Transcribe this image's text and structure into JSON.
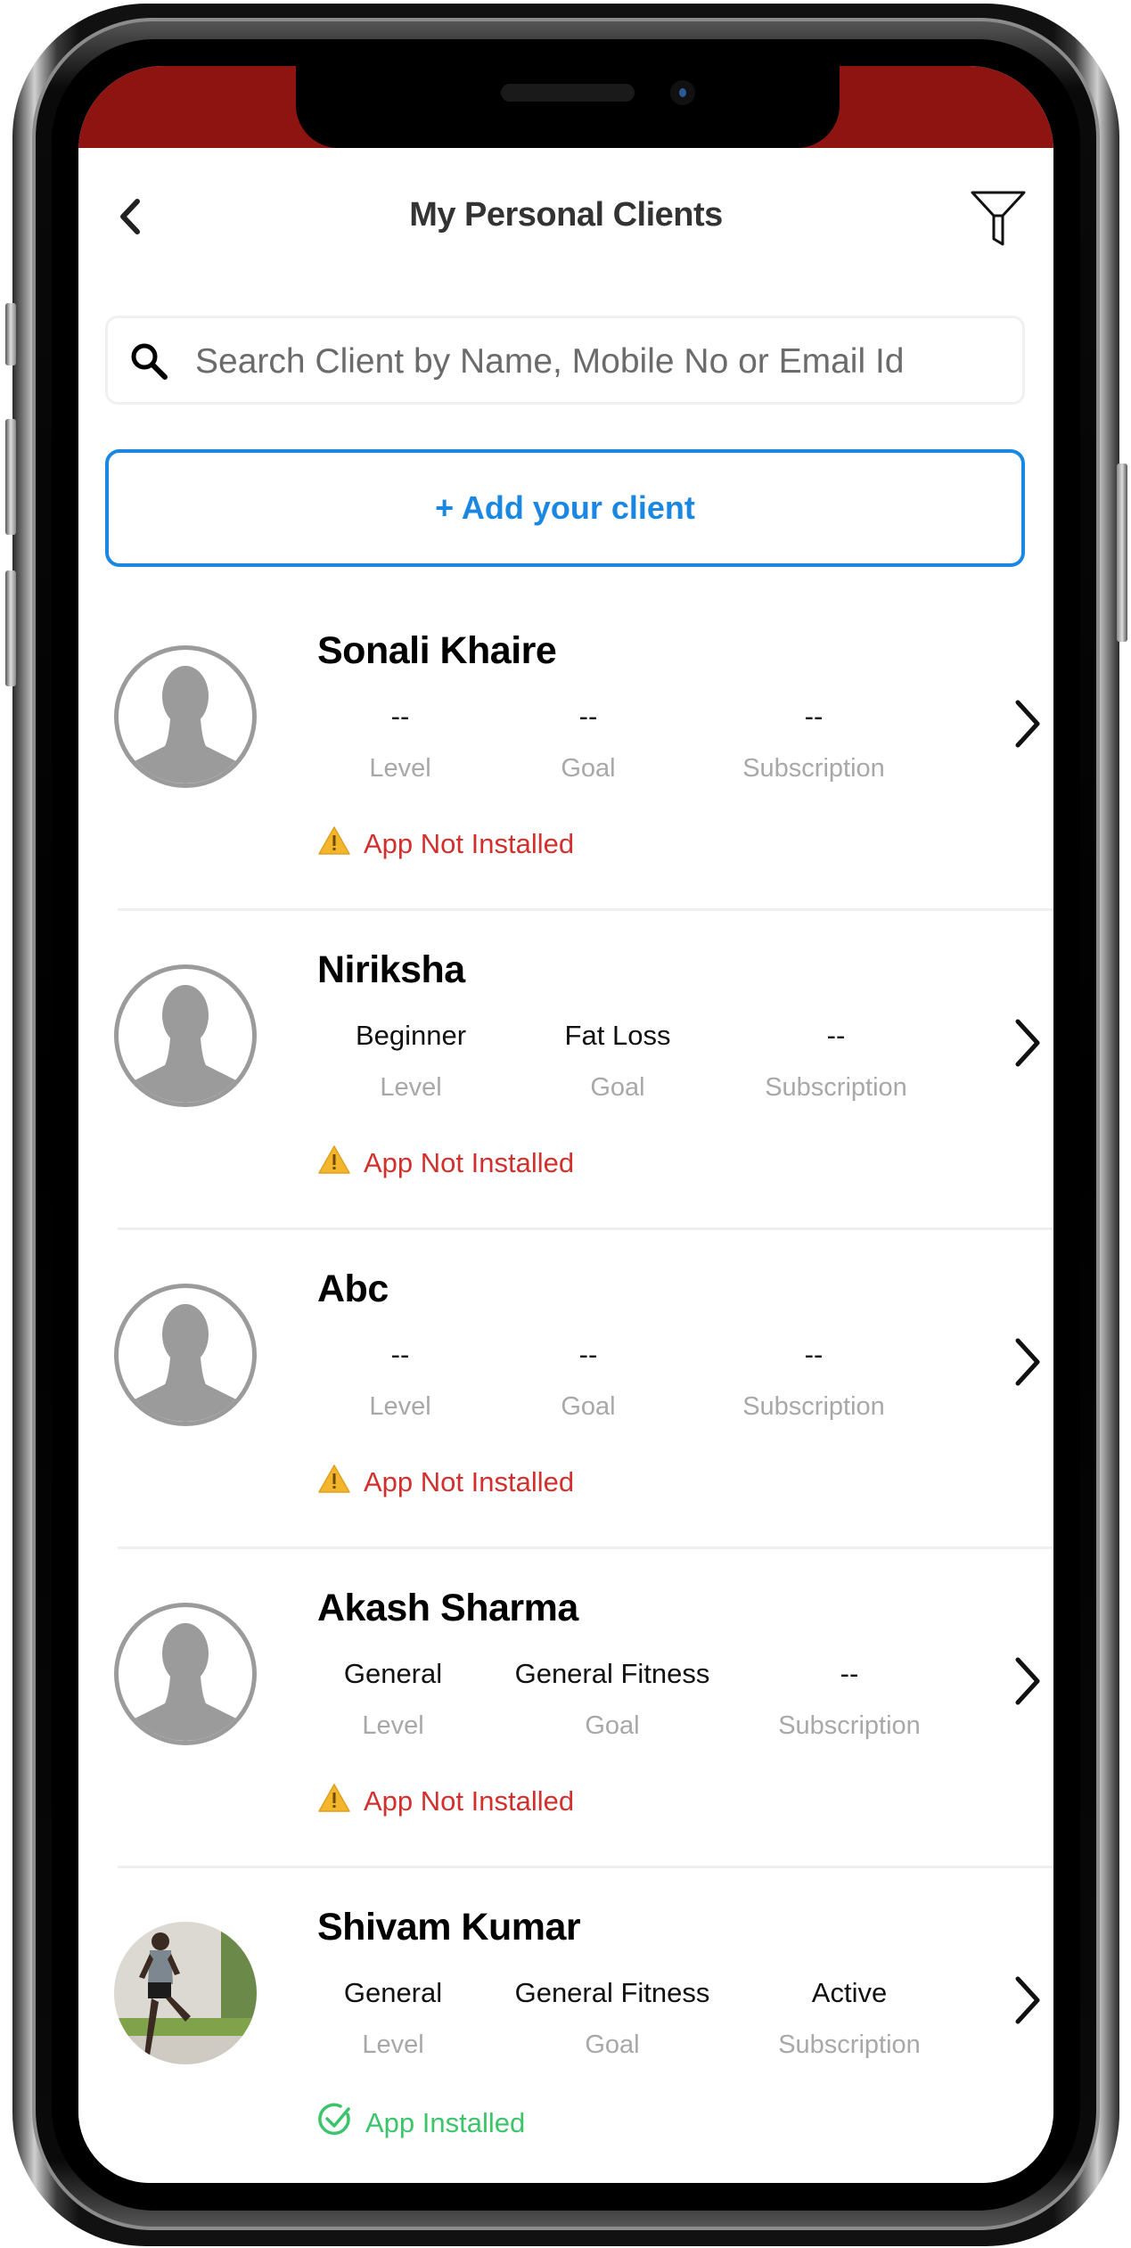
{
  "header": {
    "title": "My Personal Clients",
    "back_icon": "chevron-left-icon",
    "filter_icon": "filter-icon"
  },
  "search": {
    "placeholder": "Search Client by Name, Mobile No or Email Id",
    "value": "",
    "icon": "search-icon"
  },
  "add_button": {
    "label": "+ Add your client",
    "color": "#1a87e3"
  },
  "stat_labels": {
    "level": "Level",
    "goal": "Goal",
    "subscription": "Subscription"
  },
  "colors": {
    "status_bar": "#8e1411",
    "not_installed": "#d3302d",
    "installed": "#3cc46a",
    "accent": "#1a87e3"
  },
  "clients": [
    {
      "name": "Sonali Khaire",
      "avatar": "placeholder",
      "level": "--",
      "goal": "--",
      "subscription": "--",
      "app_status": "App Not Installed",
      "installed": false
    },
    {
      "name": "Niriksha",
      "avatar": "placeholder",
      "level": "Beginner",
      "goal": "Fat Loss",
      "subscription": "--",
      "app_status": "App Not Installed",
      "installed": false
    },
    {
      "name": "Abc",
      "avatar": "placeholder",
      "level": "--",
      "goal": "--",
      "subscription": "--",
      "app_status": "App Not Installed",
      "installed": false
    },
    {
      "name": "Akash Sharma",
      "avatar": "placeholder",
      "level": "General",
      "goal": "General Fitness",
      "subscription": "--",
      "app_status": "App Not Installed",
      "installed": false
    },
    {
      "name": "Shivam Kumar",
      "avatar": "photo",
      "level": "General",
      "goal": "General Fitness",
      "subscription": "Active",
      "app_status": "App Installed",
      "installed": true
    }
  ]
}
